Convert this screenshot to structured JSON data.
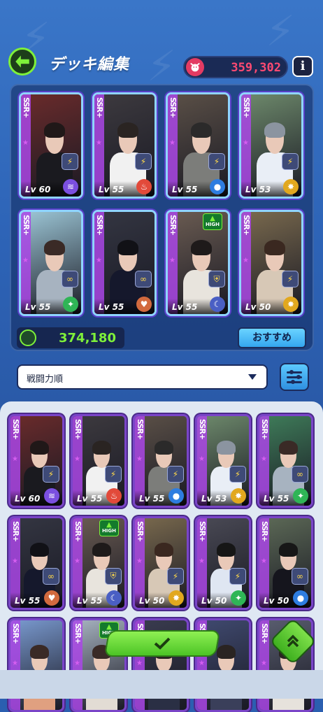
{
  "header": {
    "title": "デッキ編集",
    "currency_value": "359,302",
    "info_label": "i"
  },
  "deck": {
    "power_value": "374,180",
    "recommend_label": "おすすめ",
    "cards": [
      {
        "rarity": "SSR+",
        "level": "Lv 60",
        "attr": "wind",
        "skill": "lightning-icon",
        "hair": "#201818",
        "body": "#1a1a1f",
        "bg": "#6b2b2b"
      },
      {
        "rarity": "SSR+",
        "level": "Lv 55",
        "attr": "fire",
        "skill": "lightning-icon",
        "hair": "#2a2422",
        "body": "#f1f1f1",
        "bg": "#3d3a3f"
      },
      {
        "rarity": "SSR+",
        "level": "Lv 55",
        "attr": "water",
        "skill": "lightning-icon",
        "hair": "#2b2a2a",
        "body": "#7c7d7a",
        "bg": "#5b5047"
      },
      {
        "rarity": "SSR+",
        "level": "Lv 53",
        "attr": "light",
        "skill": "lightning-icon",
        "hair": "#8b94a0",
        "body": "#e9eef6",
        "bg": "#6e8a6c"
      },
      {
        "rarity": "SSR+",
        "level": "Lv 55",
        "attr": "leaf",
        "skill": "bond-icon",
        "hair": "#3a2a26",
        "body": "#a7b3c0",
        "bg": "#9dc7d7"
      },
      {
        "rarity": "SSR+",
        "level": "Lv 55",
        "attr": "heart",
        "skill": "bond-icon",
        "hair": "#111116",
        "body": "#15182c",
        "bg": "#343642"
      },
      {
        "rarity": "SSR+",
        "level": "Lv 55",
        "attr": "moon",
        "skill": "shield-icon",
        "hair": "#1e1a1a",
        "body": "#e8e4dd",
        "bg": "#6b5c52",
        "high": true
      },
      {
        "rarity": "SSR+",
        "level": "Lv 50",
        "attr": "light",
        "skill": "lightning-icon",
        "hair": "#3a2820",
        "body": "#d7c8b6",
        "bg": "#7a6a4e"
      }
    ]
  },
  "sort": {
    "label": "戦闘力順"
  },
  "collection": {
    "cards": [
      {
        "rarity": "SSR+",
        "level": "Lv 60",
        "attr": "wind",
        "skill": "lightning-icon",
        "hair": "#201818",
        "body": "#1a1a1f",
        "bg": "#6b2b2b"
      },
      {
        "rarity": "SSR+",
        "level": "Lv 55",
        "attr": "fire",
        "skill": "lightning-icon",
        "hair": "#2a2422",
        "body": "#f1f1f1",
        "bg": "#3d3a3f"
      },
      {
        "rarity": "SSR+",
        "level": "Lv 55",
        "attr": "water",
        "skill": "lightning-icon",
        "hair": "#2b2a2a",
        "body": "#7c7d7a",
        "bg": "#5b5047"
      },
      {
        "rarity": "SSR+",
        "level": "Lv 53",
        "attr": "light",
        "skill": "lightning-icon",
        "hair": "#8b94a0",
        "body": "#e9eef6",
        "bg": "#6e8a6c"
      },
      {
        "rarity": "SSR+",
        "level": "Lv 55",
        "attr": "leaf",
        "skill": "bond-icon",
        "hair": "#3a2a26",
        "body": "#a7b3c0",
        "bg": "#3f7d5a"
      },
      {
        "rarity": "SSR+",
        "level": "Lv 55",
        "attr": "heart",
        "skill": "bond-icon",
        "hair": "#111116",
        "body": "#15182c",
        "bg": "#343642"
      },
      {
        "rarity": "SSR+",
        "level": "Lv 55",
        "attr": "moon",
        "skill": "shield-icon",
        "hair": "#1e1a1a",
        "body": "#e8e4dd",
        "bg": "#6b5c52",
        "high": true
      },
      {
        "rarity": "SSR+",
        "level": "Lv 50",
        "attr": "light",
        "skill": "lightning-icon",
        "hair": "#3a2820",
        "body": "#d7c8b6",
        "bg": "#7a6a4e"
      },
      {
        "rarity": "SSR+",
        "level": "Lv 50",
        "attr": "leaf",
        "skill": "lightning-icon",
        "hair": "#161616",
        "body": "#dfe6f2",
        "bg": "#4a4a55"
      },
      {
        "rarity": "SSR+",
        "level": "Lv 50",
        "attr": "water",
        "skill": "bond-icon",
        "hair": "#171717",
        "body": "#15151d",
        "bg": "#5d6a57"
      },
      {
        "rarity": "SSR+",
        "level": "",
        "attr": "",
        "skill": "",
        "hair": "#3a2a26",
        "body": "#e0a080",
        "bg": "#7a9ad0"
      },
      {
        "rarity": "SSR+",
        "level": "",
        "attr": "",
        "skill": "",
        "hair": "#3a2a26",
        "body": "#e2dcd4",
        "bg": "#a7b3c0",
        "high": true
      },
      {
        "rarity": "SSR+",
        "level": "",
        "attr": "",
        "skill": "",
        "hair": "#2a2422",
        "body": "#2a2f44",
        "bg": "#3a3c50"
      },
      {
        "rarity": "SSR+",
        "level": "",
        "attr": "",
        "skill": "",
        "hair": "#2a2422",
        "body": "#3a3f5a",
        "bg": "#404a70"
      },
      {
        "rarity": "SSR+",
        "level": "",
        "attr": "",
        "skill": "",
        "hair": "#2a2422",
        "body": "#e6e2dc",
        "bg": "#5a5e70"
      }
    ]
  },
  "colors": {
    "wind": "#7b4fe0",
    "fire": "#e24a3a",
    "water": "#2e7de0",
    "light": "#e2a81e",
    "leaf": "#2fb556",
    "heart": "#d26a3e",
    "moon": "#4a5fc4"
  }
}
